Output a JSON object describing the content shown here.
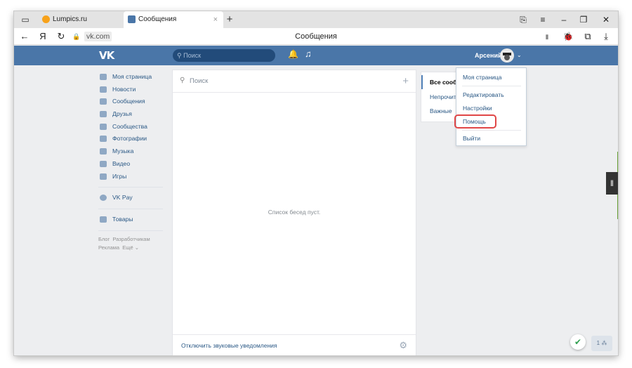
{
  "browser": {
    "tabs": [
      {
        "label": "Lumpics.ru",
        "favicon_color": "#f7a21b"
      },
      {
        "label": "Сообщения",
        "favicon_color": "#4a76a8"
      }
    ],
    "new_tab": "+",
    "close_tab": "×",
    "window_controls": {
      "minimize": "–",
      "restore": "❐",
      "close": "✕",
      "menu": "≡",
      "bookmark": "⎘"
    },
    "address": "vk.com",
    "page_title": "Сообщения",
    "nav": {
      "back": "←",
      "yandex": "Я",
      "reload": "↻",
      "lock": "🔒"
    },
    "right_icons": {
      "bookmark": "▮",
      "bug": "🐞",
      "collections": "⧉",
      "download": "⤓"
    }
  },
  "vk": {
    "logo": "VK",
    "search_placeholder": "Поиск",
    "user_name": "Арсений",
    "nav": [
      {
        "label": "Моя страница",
        "icon": "home-icon"
      },
      {
        "label": "Новости",
        "icon": "news-icon"
      },
      {
        "label": "Сообщения",
        "icon": "messages-icon"
      },
      {
        "label": "Друзья",
        "icon": "friends-icon"
      },
      {
        "label": "Сообщества",
        "icon": "groups-icon"
      },
      {
        "label": "Фотографии",
        "icon": "photo-icon"
      },
      {
        "label": "Музыка",
        "icon": "music-icon"
      },
      {
        "label": "Видео",
        "icon": "video-icon"
      },
      {
        "label": "Игры",
        "icon": "games-icon"
      }
    ],
    "vkpay": "VK Pay",
    "goods": "Товары",
    "footer": {
      "blog": "Блог",
      "dev": "Разработчикам",
      "ads": "Реклама",
      "more": "Ещё ⌄"
    },
    "messages": {
      "search_placeholder": "Поиск",
      "empty_text": "Список бесед пуст.",
      "mute_link": "Отключить звуковые уведомления"
    },
    "filters": [
      "Все сообщения",
      "Непрочитанные",
      "Важные"
    ],
    "dropdown": [
      "Моя страница",
      "Редактировать",
      "Настройки",
      "Помощь",
      "Выйти"
    ],
    "counter": "1 ⁂"
  }
}
